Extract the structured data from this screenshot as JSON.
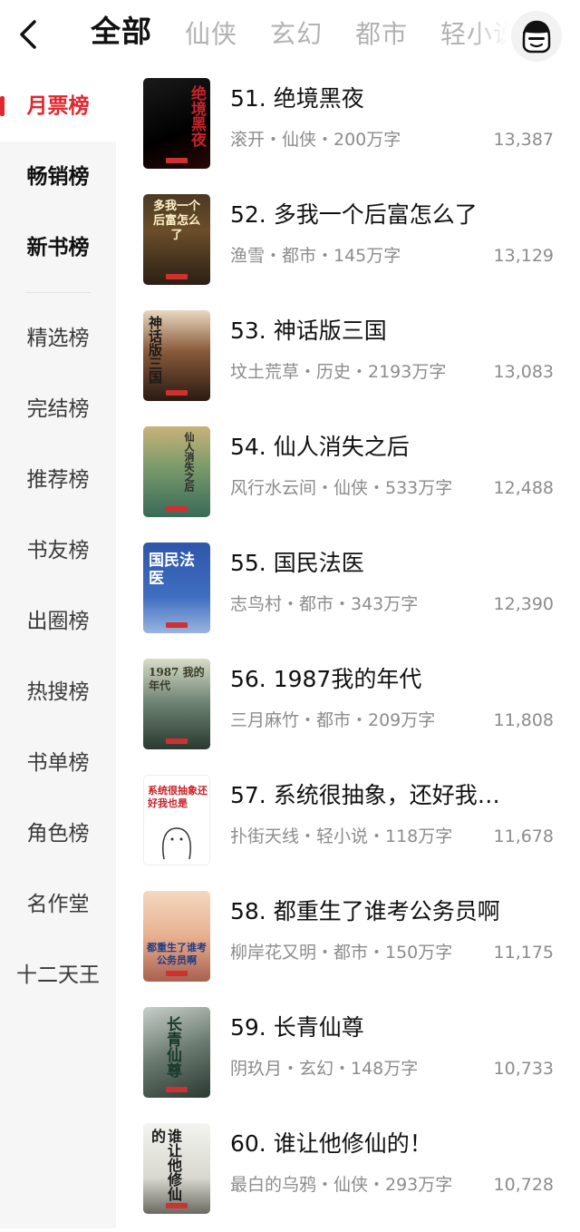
{
  "header": {
    "tabs": [
      {
        "label": "全部",
        "active": true
      },
      {
        "label": "仙侠",
        "active": false
      },
      {
        "label": "玄幻",
        "active": false
      },
      {
        "label": "都市",
        "active": false
      },
      {
        "label": "轻小说",
        "active": false
      }
    ],
    "back_icon": "chevron-left-icon",
    "avatar_icon": "avatar-face-icon"
  },
  "sidebar": {
    "items": [
      {
        "label": "月票榜"
      },
      {
        "label": "畅销榜"
      },
      {
        "label": "新书榜"
      },
      {
        "label": "精选榜"
      },
      {
        "label": "完结榜"
      },
      {
        "label": "推荐榜"
      },
      {
        "label": "书友榜"
      },
      {
        "label": "出圈榜"
      },
      {
        "label": "热搜榜"
      },
      {
        "label": "书单榜"
      },
      {
        "label": "角色榜"
      },
      {
        "label": "名作堂"
      },
      {
        "label": "十二天王"
      }
    ]
  },
  "books": [
    {
      "title": "51. 绝境黑夜",
      "meta": "滚开・仙侠・200万字",
      "votes": "13,387",
      "cover_text": "绝境黑夜"
    },
    {
      "title": "52. 多我一个后富怎么了",
      "meta": "渔雪・都市・145万字",
      "votes": "13,129",
      "cover_text": "多我一个后富怎么了"
    },
    {
      "title": "53. 神话版三国",
      "meta": "坟土荒草・历史・2193万字",
      "votes": "13,083",
      "cover_text": "神话版三国"
    },
    {
      "title": "54. 仙人消失之后",
      "meta": "风行水云间・仙侠・533万字",
      "votes": "12,488",
      "cover_text": "仙人消失之后"
    },
    {
      "title": "55. 国民法医",
      "meta": "志鸟村・都市・343万字",
      "votes": "12,390",
      "cover_text": "国民法医"
    },
    {
      "title": "56. 1987我的年代",
      "meta": "三月麻竹・都市・209万字",
      "votes": "11,808",
      "cover_text": "1987 我的年代"
    },
    {
      "title": "57. 系统很抽象，还好我…",
      "meta": "扑街天线・轻小说・118万字",
      "votes": "11,678",
      "cover_text": "系统很抽象还好我也是"
    },
    {
      "title": "58. 都重生了谁考公务员啊",
      "meta": "柳岸花又明・都市・150万字",
      "votes": "11,175",
      "cover_text": "都重生了谁考公务员啊"
    },
    {
      "title": "59. 长青仙尊",
      "meta": "阴玖月・玄幻・148万字",
      "votes": "10,733",
      "cover_text": "长青仙尊"
    },
    {
      "title": "60. 谁让他修仙的！",
      "meta": "最白的乌鸦・仙侠・293万字",
      "votes": "10,728",
      "cover_text": "谁让他修仙的"
    }
  ],
  "colors": {
    "accent": "#e0272e",
    "muted": "#8c8c8c",
    "sidebar_bg": "#f6f6f6"
  }
}
